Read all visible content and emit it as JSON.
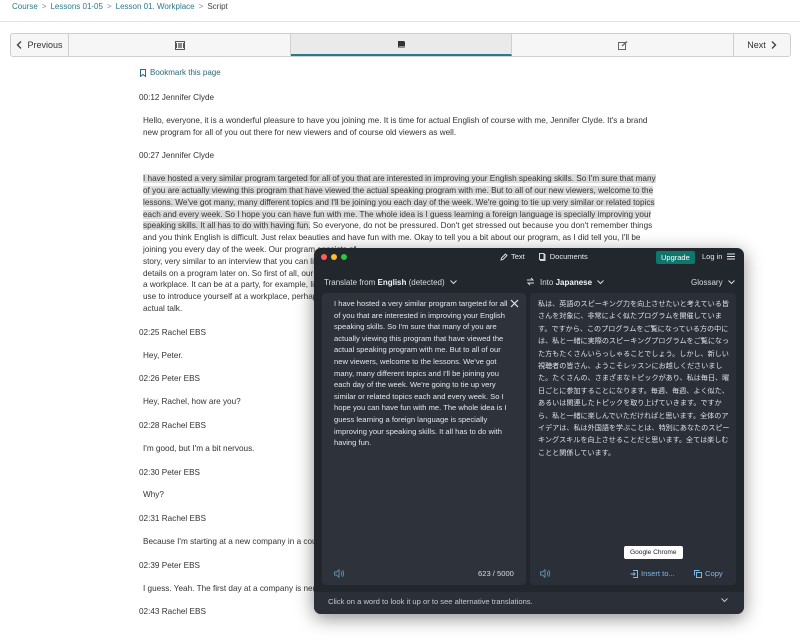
{
  "breadcrumb": [
    "Course",
    "Lessons 01-05",
    "Lesson 01. Workplace",
    "Script"
  ],
  "nav": {
    "prev": "Previous",
    "next": "Next",
    "tab_icons": [
      "film-icon",
      "book-icon",
      "edit-icon"
    ]
  },
  "bookmark": "Bookmark this page",
  "script": [
    {
      "ts": "00:12 Jennifer Clyde",
      "text": "Hello, everyone, it is a wonderful pleasure to have you joining me. It is time for actual English of course with me, Jennifer Clyde. It's a brand new program for all of you out there for new viewers and of course old viewers as well."
    },
    {
      "ts": "00:27 Jennifer Clyde",
      "hl": "I have hosted a very similar program targeted for all of you that are interested in improving your English speaking skills. So I'm sure that many of you are actually viewing this program that have viewed the actual speaking program with me. But to all of our new viewers, welcome to the lessons. We've got many, many different topics and I'll be joining you each day of the week. We're going to tie up very similar or related topics each and every week. So I hope you can have fun with me. The whole idea is I guess learning a foreign language is specially improving your speaking skills. It all has to do with having fun.",
      "rest": " So everyone, do not be pressured. Don't get stressed out because you don't remember things and you think English is difficult. Just relax beauties and have fun with me. Okay to tell you a bit about our program, as I did tell you, I'll be joining you every day of the week. Our program consists of",
      "l3": "story, very similar to an interview that you can lis",
      "l4": "details on a program later on. So first of all, our t",
      "l5": "a workplace. It can be at a party, for example, lik",
      "l6": "use to introduce yourself at a workplace, perhap",
      "l7": "actual talk."
    },
    {
      "ts": "02:25 Rachel EBS",
      "text": "Hey, Peter."
    },
    {
      "ts": "02:26 Peter EBS",
      "text": "Hey, Rachel, how are you?"
    },
    {
      "ts": "02:28 Rachel EBS",
      "text": "I'm good, but I'm a bit nervous."
    },
    {
      "ts": "02:30 Peter EBS",
      "text": "Why?"
    },
    {
      "ts": "02:31 Rachel EBS",
      "text": "Because I'm starting at a new company in a cou"
    },
    {
      "ts": "02:39 Peter EBS",
      "text": "I guess. Yeah. The first day at a company is nerv"
    },
    {
      "ts": "02:43 Rachel EBS",
      "text": ""
    }
  ],
  "translator": {
    "tabs": [
      "Text",
      "Documents"
    ],
    "upgrade": "Upgrade",
    "login": "Log in",
    "from_prefix": "Translate from ",
    "from_lang": "English",
    "from_suffix": " (detected)",
    "into_prefix": "Into ",
    "into_lang": "Japanese",
    "glossary": "Glossary",
    "source": "I have hosted a very similar program targeted for all of you that are interested in improving your English speaking skills. So I'm sure that many of you are actually viewing this program that have viewed the actual speaking program with me. But to all of our new viewers, welcome to the lessons. We've got many, many different topics and I'll be joining you each day of the week. We're going to tie up very similar or related topics each and every week. So I hope you can have fun with me. The whole idea is I guess learning a foreign language is specially improving your speaking skills. It all has to do with having fun.",
    "target": "私は、英語のスピーキング力を向上させたいと考えている皆さんを対象に、非常によく似たプログラムを開催しています。ですから、このプログラムをご覧になっている方の中には、私と一緒に実際のスピーキングプログラムをご覧になった方もたくさんいらっしゃることでしょう。しかし、新しい視聴者の皆さん、ようこそレッスンにお越しくださいました。たくさんの、さまざまなトピックがあり、私は毎日、曜日ごとに参加することになります。毎週、毎週、よく似た、あるいは関連したトピックを取り上げていきます。ですから、私と一緒に楽しんでいただければと思います。全体のアイデアは、私は外国語を学ぶことは、特別にあなたのスピーキングスキルを向上させることだと思います。全ては楽しむことと関係しています。",
    "count": "623 / 5000",
    "insert": "Insert to...",
    "copy": "Copy",
    "tooltip": "Google Chrome",
    "hint": "Click on a word to look it up or to see alternative translations."
  },
  "colors": {
    "link": "#2a7a8c",
    "upgrade": "#0f766e",
    "window_bg": "#22262d"
  }
}
